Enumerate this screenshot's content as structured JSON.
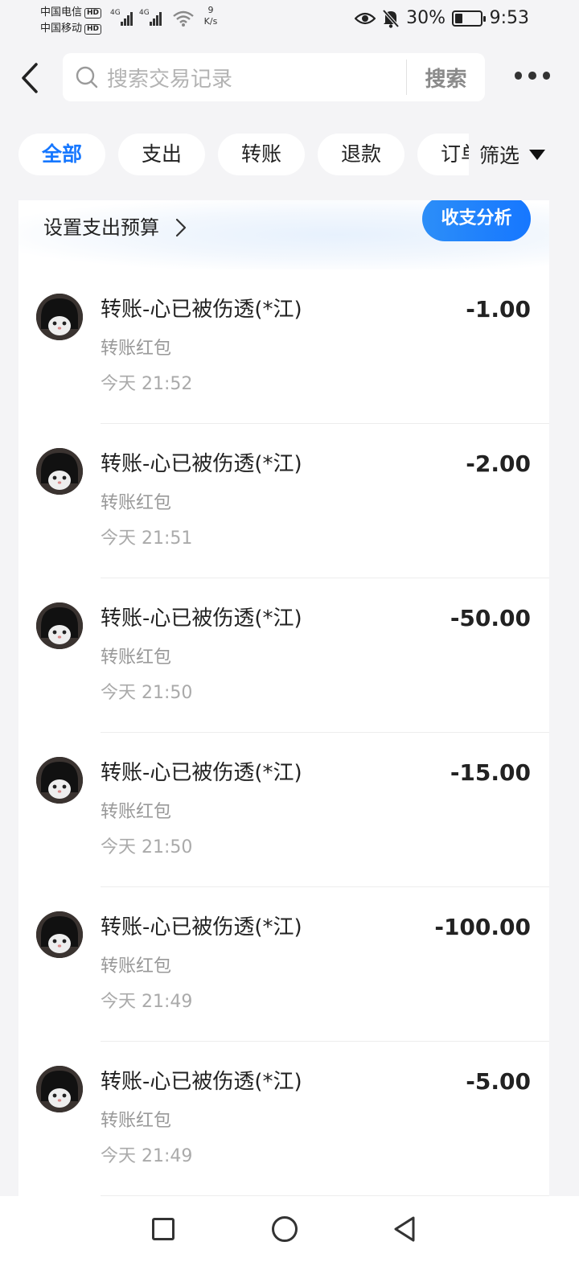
{
  "status_bar": {
    "carrier_1": "中国电信",
    "carrier_2": "中国移动",
    "hd_badge": "HD",
    "network_1": "4G",
    "network_2": "4G",
    "speed_value": "9",
    "speed_unit": "K/s",
    "battery_percent": "30%",
    "battery_level": 0.3,
    "time": "9:53",
    "icons": [
      "eye-icon",
      "mute-bell-icon",
      "wifi-icon",
      "signal-icon",
      "battery-icon"
    ]
  },
  "header": {
    "search_placeholder": "搜索交易记录",
    "search_button": "搜索"
  },
  "tabs": [
    {
      "label": "全部",
      "active": true
    },
    {
      "label": "支出",
      "active": false
    },
    {
      "label": "转账",
      "active": false
    },
    {
      "label": "退款",
      "active": false
    },
    {
      "label": "订单",
      "active": false
    }
  ],
  "filter_label": "筛选",
  "budget": {
    "label": "设置支出预算",
    "analysis_button": "收支分析"
  },
  "transactions": [
    {
      "title": "转账-心已被伤透(*江)",
      "subtitle": "转账红包",
      "time": "今天 21:52",
      "amount": "-1.00"
    },
    {
      "title": "转账-心已被伤透(*江)",
      "subtitle": "转账红包",
      "time": "今天 21:51",
      "amount": "-2.00"
    },
    {
      "title": "转账-心已被伤透(*江)",
      "subtitle": "转账红包",
      "time": "今天 21:50",
      "amount": "-50.00"
    },
    {
      "title": "转账-心已被伤透(*江)",
      "subtitle": "转账红包",
      "time": "今天 21:50",
      "amount": "-15.00"
    },
    {
      "title": "转账-心已被伤透(*江)",
      "subtitle": "转账红包",
      "time": "今天 21:49",
      "amount": "-100.00"
    },
    {
      "title": "转账-心已被伤透(*江)",
      "subtitle": "转账红包",
      "time": "今天 21:49",
      "amount": "-5.00"
    }
  ],
  "colors": {
    "accent": "#1677ff",
    "background": "#f4f4f6",
    "secondary_text": "#999999"
  }
}
